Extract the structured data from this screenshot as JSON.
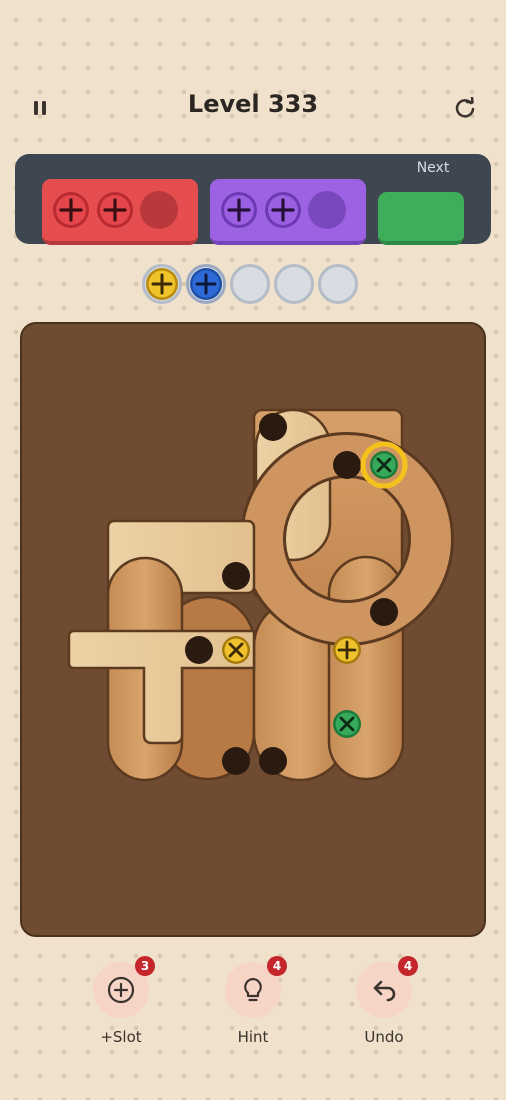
{
  "header": {
    "title": "Level 333"
  },
  "icons": {
    "pause": "pause-icon",
    "restart": "restart-icon"
  },
  "tray": {
    "next_label": "Next",
    "boxes": [
      {
        "color": "red",
        "filled": 2,
        "capacity": 3
      },
      {
        "color": "purple",
        "filled": 2,
        "capacity": 3
      },
      {
        "color": "green",
        "filled": 0,
        "capacity": 0
      }
    ]
  },
  "holding_slots": [
    "yellow",
    "blue",
    "empty",
    "empty",
    "empty"
  ],
  "toolbar": {
    "slot": {
      "label": "+Slot",
      "count": "3",
      "icon": "plus-circle-icon"
    },
    "hint": {
      "label": "Hint",
      "count": "4",
      "icon": "lightbulb-icon"
    },
    "undo": {
      "label": "Undo",
      "count": "4",
      "icon": "undo-icon"
    }
  },
  "colors": {
    "red": "#e54d4f",
    "purple": "#9d61e3",
    "green": "#3fae5a",
    "yellow": "#e8b923",
    "blue": "#2f6bd8",
    "board": "#6e4b31",
    "badge": "#c4262b"
  }
}
